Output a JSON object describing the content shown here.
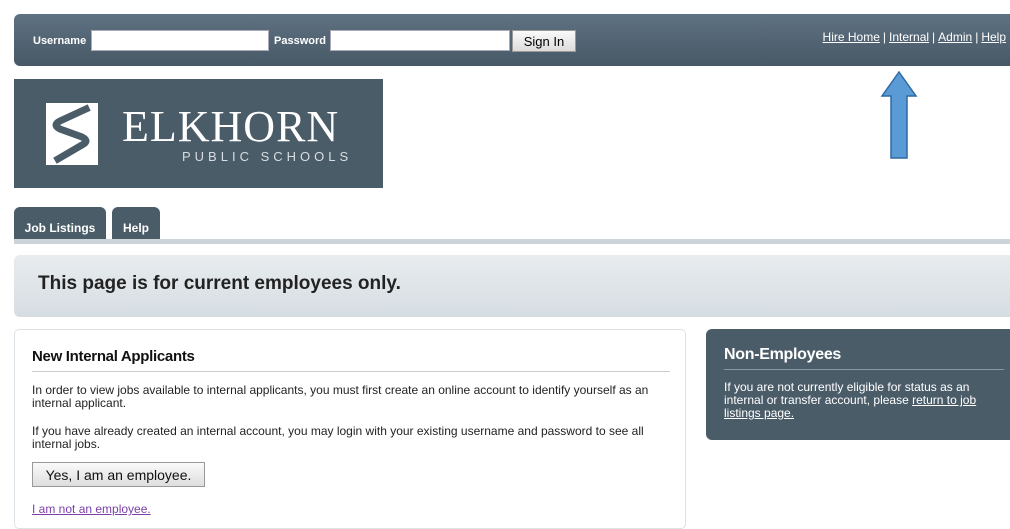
{
  "header": {
    "username_label": "Username",
    "username_value": "",
    "password_label": "Password",
    "password_value": "",
    "signin_label": "Sign In",
    "links": [
      "Hire Home",
      "Internal",
      "Admin",
      "Help"
    ],
    "separator": "|"
  },
  "logo": {
    "name": "ELKHORN",
    "subtitle": "PUBLIC SCHOOLS"
  },
  "tabs": [
    {
      "label": "Job Listings"
    },
    {
      "label": "Help"
    }
  ],
  "notice": {
    "text": "This page is for current employees only."
  },
  "internal": {
    "title": "New Internal Applicants",
    "para1": "In order to view jobs available to internal applicants, you must first create an online account to identify yourself as an internal applicant.",
    "para2": "If you have already created an internal account, you may login with your existing username and password to see all internal jobs.",
    "button_label": "Yes, I am an employee.",
    "not_employee_link": "I am not an employee."
  },
  "nonemployees": {
    "title": "Non-Employees",
    "text": "If you are not currently eligible for status as an internal or transfer account, please ",
    "link": "return to job listings page."
  },
  "colors": {
    "header_bg": "#4b5c69",
    "arrow": "#5b9bd5",
    "visited_link": "#7b3fa8"
  },
  "icons": {
    "logo_mark": "elkhorn-river-s-icon",
    "annotation": "up-arrow-icon"
  }
}
